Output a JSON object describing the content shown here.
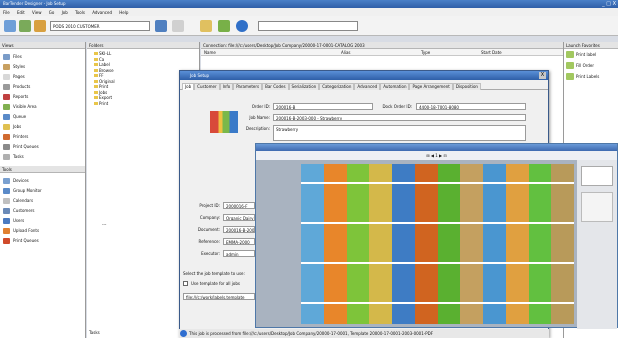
{
  "window": {
    "title": "BarTender Designer - Job Setup",
    "controls": "_ □ X"
  },
  "menu": [
    "File",
    "Edit",
    "View",
    "Go",
    "Job",
    "Tools",
    "Advanced",
    "Help"
  ],
  "toolbar": {
    "combo1": "PODS 2010 CUSTOMER",
    "combo2": ""
  },
  "left_pane": {
    "title": "Views",
    "items": [
      "Files",
      "Styles",
      "Pages",
      "Products",
      "Reports",
      "Visible Area",
      "Queue",
      "Jobs",
      "Printers",
      "Print Queues",
      "Tasks"
    ],
    "section2": "Tools",
    "items2": [
      "Devices",
      "Group Monitor",
      "Calendars",
      "Customers",
      "Users",
      "Upload Fonts",
      "Print Queues"
    ]
  },
  "tree_pane": {
    "title": "Folders",
    "items": [
      "SKI-LL",
      "Ca",
      "Label",
      "Browse",
      "FF",
      "Original",
      "Print",
      "Jobs",
      "Export",
      "Print"
    ],
    "footer": "Tasks",
    "dash": "---"
  },
  "list_pane": {
    "path": "Connection: file:///c:/users/Desktop/Job Company/20000-17-0001-CATALOG 2003",
    "headers": [
      "Name",
      "Alias",
      "Type",
      "Start Date"
    ]
  },
  "right_pane": {
    "title": "Launch Favorites",
    "items": [
      "Print label",
      "Fill Order",
      "Print Labels"
    ]
  },
  "dialog": {
    "title": "Job Setup",
    "close": "X",
    "tabs": [
      "Job",
      "Customer",
      "Info",
      "Parameters",
      "Bar Codes",
      "Serialization",
      "Categorization",
      "Advanced",
      "Automation",
      "Page Arrangement",
      "Disposition"
    ],
    "order_label": "Order ID:",
    "order_value": "200016-B",
    "dock_label": "Dock Order ID:",
    "dock_value": "4400-18-7001-8080",
    "job_name_label": "Job Name:",
    "job_name_value": "200016-B-2003-000 - Strawberry",
    "desc_label": "Description:",
    "desc_value": "Strawberry",
    "project_label": "Project ID:",
    "project_value": "2000016-F",
    "company_label": "Company:",
    "company_value": "Organic Dairy",
    "document_label": "Document:",
    "document_value": "200016-B-2003",
    "reference_label": "Reference:",
    "reference_value": "EMMA-2000",
    "exec_label": "Executor:",
    "exec_value": "admin",
    "select_label": "Select the job template to use:",
    "checkbox_label": "Use template for all jobs",
    "file_value": "file:///c:/work/labels.template"
  },
  "preview": {
    "toolbar": "⊞  ◀  1  ▶  ⊟"
  },
  "status": {
    "text": "This job is processed from file:///c:/users/Desktop/Job Company/20000-17-0001, Template 20000-17-0001-2003-0001-PDF"
  },
  "colors": {
    "label_colors": [
      "#5fa8d8",
      "#e8862a",
      "#7ec43a",
      "#d4b84a",
      "#3e7cc4",
      "#d06420",
      "#5ab030",
      "#c4a060",
      "#4a96d0",
      "#e0a040",
      "#62c040",
      "#b89a5a"
    ]
  }
}
